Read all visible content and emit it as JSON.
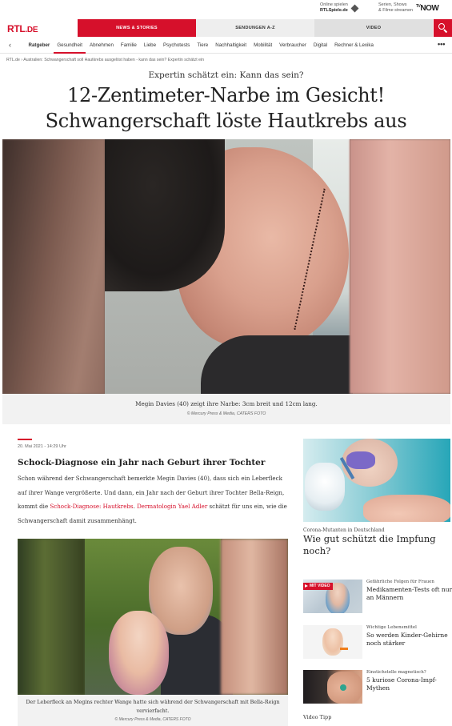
{
  "utility": {
    "online_line1": "Online spielen",
    "online_line2": "RTLSpiele.de",
    "serien_line1": "Serien, Shows",
    "serien_line2": "& Filme streamen",
    "tvnow": "NOW",
    "tvnow_prefix": "TV"
  },
  "header": {
    "logo_rtl": "RTL",
    "logo_de": ".DE",
    "tabs": [
      "NEWS & STORIES",
      "SENDUNGEN A-Z",
      "VIDEO"
    ]
  },
  "subnav": {
    "items": [
      "Ratgeber",
      "Gesundheit",
      "Abnehmen",
      "Familie",
      "Liebe",
      "Psychotests",
      "Tiere",
      "Nachhaltigkeit",
      "Mobilität",
      "Verbraucher",
      "Digital",
      "Rechner & Lexika"
    ],
    "active": "Gesundheit",
    "more": "•••",
    "back": "‹"
  },
  "breadcrumb": "RTL.de  ›  Australien: Schwangerschaft soll Hautkrebs ausgelöst haben - kann das sein? Expertin schätzt ein",
  "article": {
    "kicker": "Expertin schätzt ein: Kann das sein?",
    "headline_line1": "12-Zentimeter-Narbe im Gesicht!",
    "headline_line2": "Schwangerschaft löste Hautkrebs aus",
    "hero_caption": "Megin Davies (40) zeigt ihre Narbe: 3cm breit und 12cm lang.",
    "hero_credit": "© Mercury Press & Media, CATERS FOTO",
    "date": "20. Mai 2021 - 14:29 Uhr",
    "subtitle": "Schock-Diagnose ein Jahr nach Geburt ihrer Tochter",
    "body_part1": "Schon während der Schwangerschaft bemerkte Megin Davies (40), dass sich ein Leberfleck auf ihrer Wange vergrößerte. Und dann, ein Jahr nach der Geburt ihrer Tochter Bella-Reign, kommt die ",
    "body_link1": "Schock-Diagnose: Hautkrebs",
    "body_part2": ". ",
    "body_link2": "Dermatologin Yael Adler",
    "body_part3": " schätzt für uns ein, wie die Schwangerschaft damit zusammenhängt.",
    "image_caption": "Der Leberfleck an Megins rechter Wange hatte sich während der Schwangerschaft mit Bella-Reign vervierfacht.",
    "image_credit": "© Mercury Press & Media, CATERS FOTO"
  },
  "sidebar": {
    "main_kicker": "Corona-Mutanten in Deutschland",
    "main_title": "Wie gut schützt die Impfung noch?",
    "items": [
      {
        "kicker": "Gefährliche Folgen für Frauen",
        "title": "Medikamenten-Tests oft nur an Männern",
        "badge": "MIT VIDEO"
      },
      {
        "kicker": "Wichtige Lebensmittel",
        "title": "So werden Kinder-Gehirne noch stärker"
      },
      {
        "kicker": "Einstichstelle magnetisch?",
        "title": "5 kuriose Corona-Impf-Mythen"
      }
    ],
    "video_tipp": "Video Tipp"
  },
  "colors": {
    "accent": "#d6102b"
  }
}
